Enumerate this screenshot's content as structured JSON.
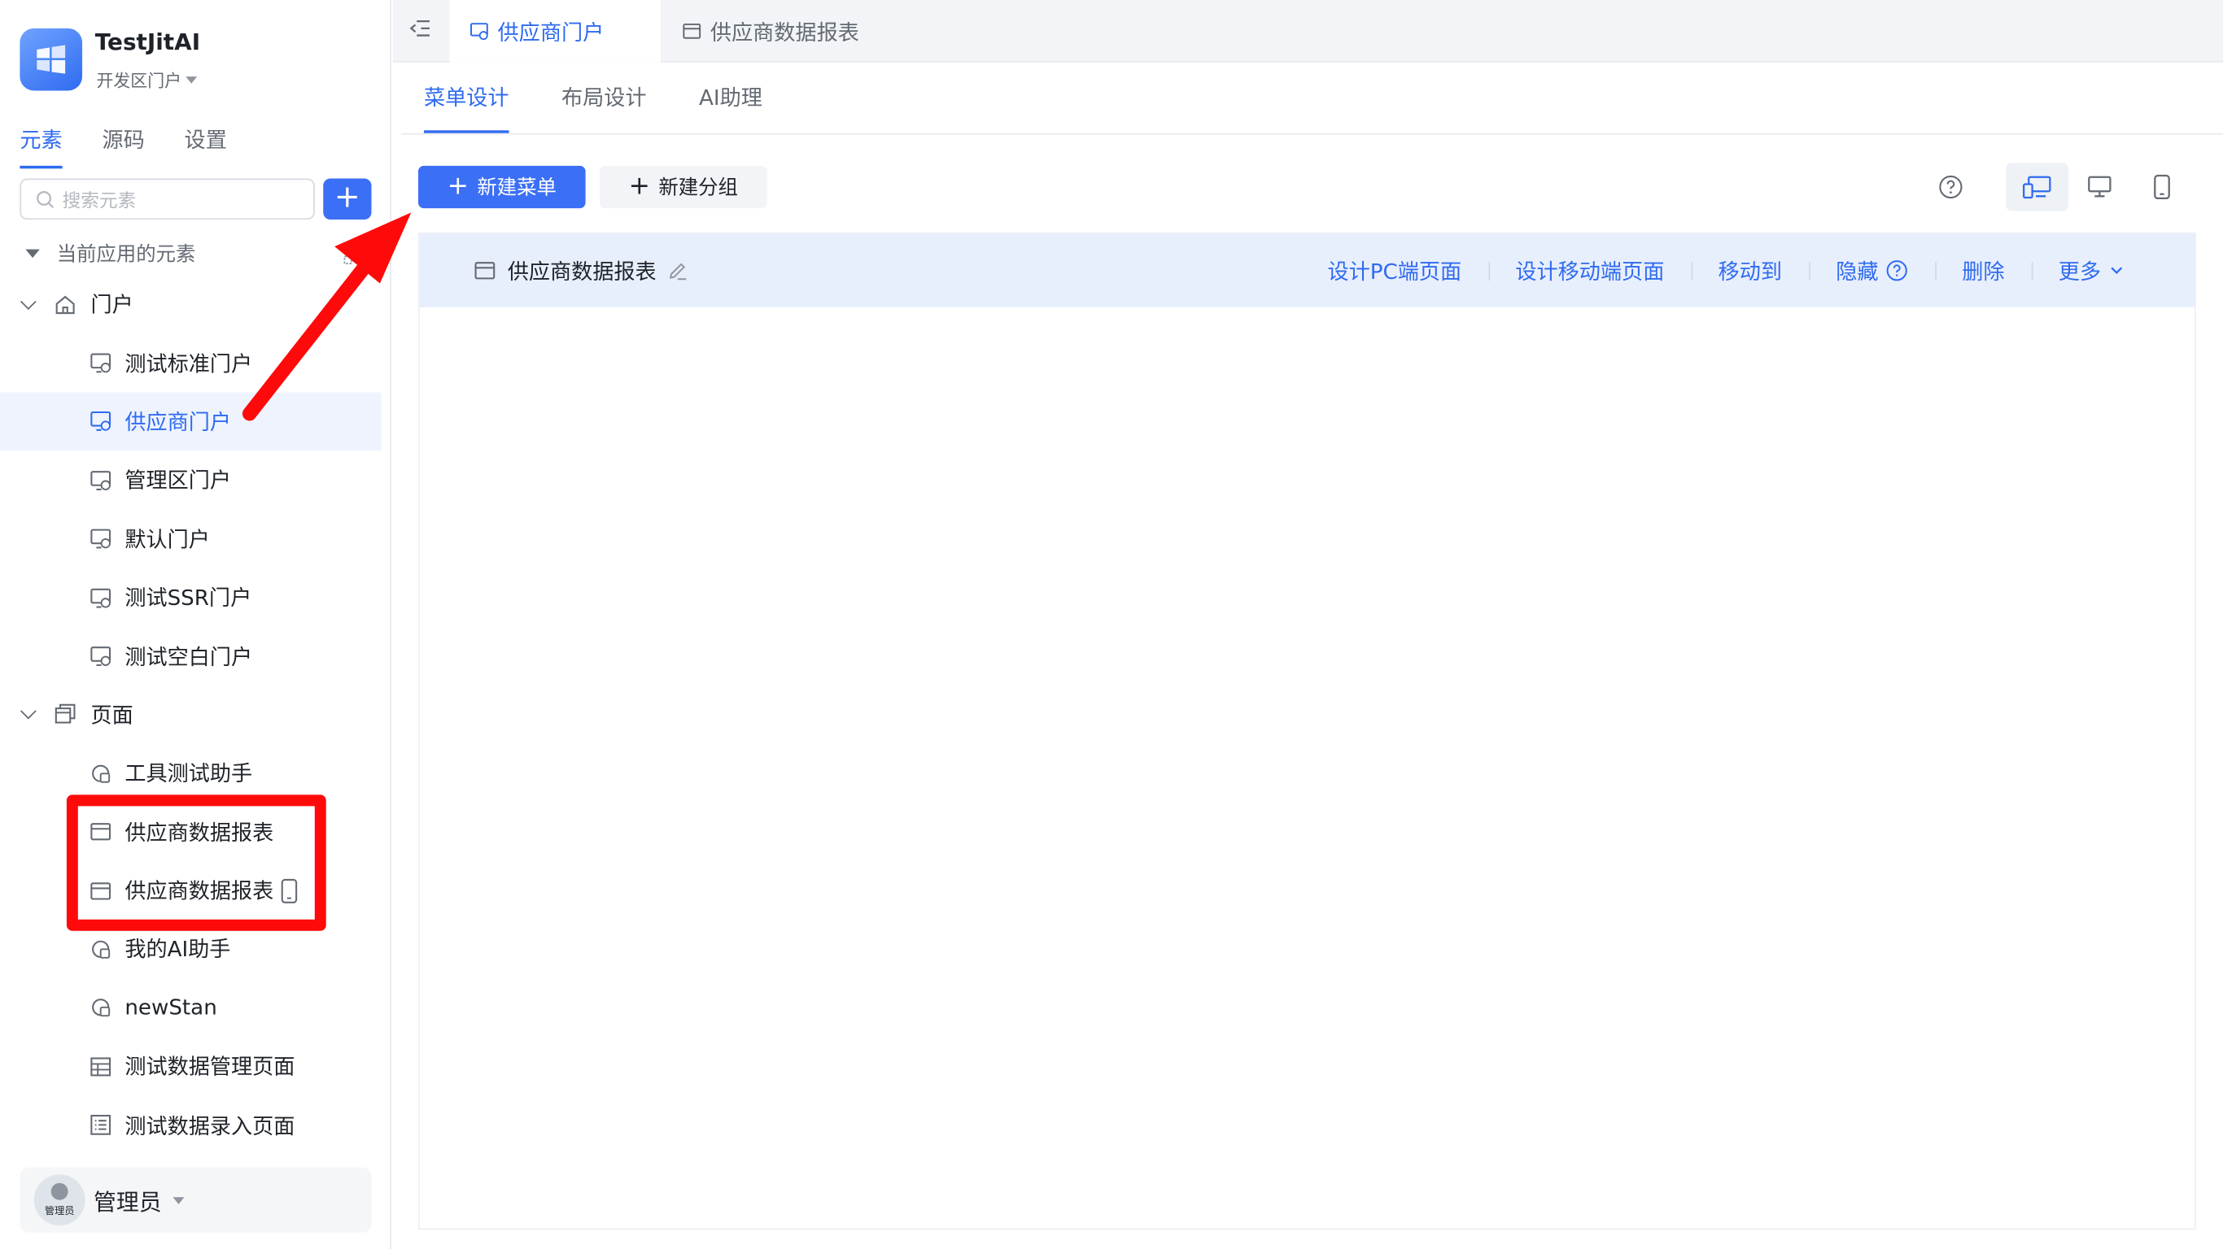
{
  "app": {
    "name": "TestJitAI",
    "portal": "开发区门户"
  },
  "sidebar": {
    "tabs": [
      "元素",
      "源码",
      "设置"
    ],
    "search_placeholder": "搜索元素",
    "section_label": "当前应用的元素",
    "groups": [
      {
        "label": "门户",
        "items": [
          "测试标准门户",
          "供应商门户",
          "管理区门户",
          "默认门户",
          "测试SSR门户",
          "测试空白门户"
        ]
      },
      {
        "label": "页面",
        "items": [
          "工具测试助手",
          "供应商数据报表",
          "供应商数据报表",
          "我的AI助手",
          "newStan",
          "测试数据管理页面",
          "测试数据录入页面"
        ]
      }
    ],
    "selected_item": "供应商门户",
    "user": {
      "name": "管理员",
      "avatar_badge": "管理员"
    }
  },
  "topbar": {
    "tabs": [
      {
        "label": "供应商门户",
        "active": true
      },
      {
        "label": "供应商数据报表",
        "active": false
      }
    ]
  },
  "subtabs": [
    "菜单设计",
    "布局设计",
    "AI助理"
  ],
  "toolbar": {
    "new_menu": "新建菜单",
    "new_group": "新建分组"
  },
  "menu_row": {
    "title": "供应商数据报表",
    "actions": [
      "设计PC端页面",
      "设计移动端页面",
      "移动到",
      "隐藏",
      "删除",
      "更多"
    ]
  },
  "colors": {
    "accent": "#2f6bf0",
    "selected_bg": "#eef3fe",
    "annotation_red": "#ff0a0a"
  }
}
